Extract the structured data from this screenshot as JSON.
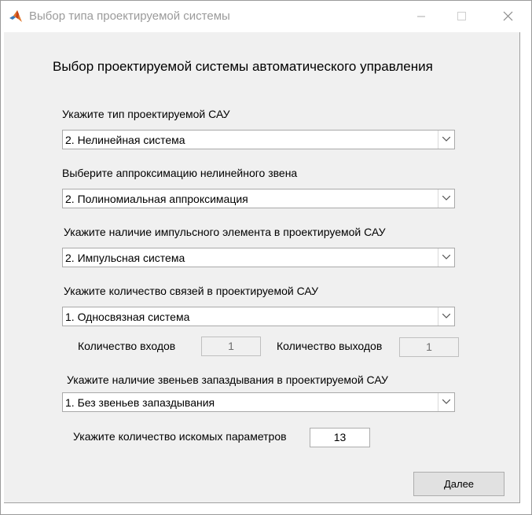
{
  "window": {
    "title": "Выбор типа проектируемой системы"
  },
  "heading": "Выбор проектируемой системы автоматического управления",
  "fields": {
    "system_type": {
      "label": "Укажите тип проектируемой САУ",
      "value": "2. Нелинейная система"
    },
    "approximation": {
      "label": "Выберите аппроксимацию нелинейного звена",
      "value": "2. Полиномиальная аппроксимация"
    },
    "impulse": {
      "label": "Укажите наличие импульсного элемента в проектируемой САУ",
      "value": "2. Импульсная система"
    },
    "links": {
      "label": "Укажите количество связей в проектируемой САУ",
      "value": "1. Односвязная система"
    },
    "inputs": {
      "label": "Количество входов",
      "value": "1"
    },
    "outputs": {
      "label": "Количество выходов",
      "value": "1"
    },
    "delay": {
      "label": "Укажите наличие звеньев запаздывания в проектируемой САУ",
      "value": "1. Без звеньев запаздывания"
    },
    "params": {
      "label": "Укажите количество искомых параметров",
      "value": "13"
    }
  },
  "buttons": {
    "next": "Далее"
  },
  "icons": {
    "app": "matlab-icon",
    "combo_arrow": "chevron-down-icon"
  },
  "colors": {
    "client_bg": "#f0f0f0",
    "titlebar_text": "#9b9b9b",
    "button_bg": "#e1e1e1"
  }
}
